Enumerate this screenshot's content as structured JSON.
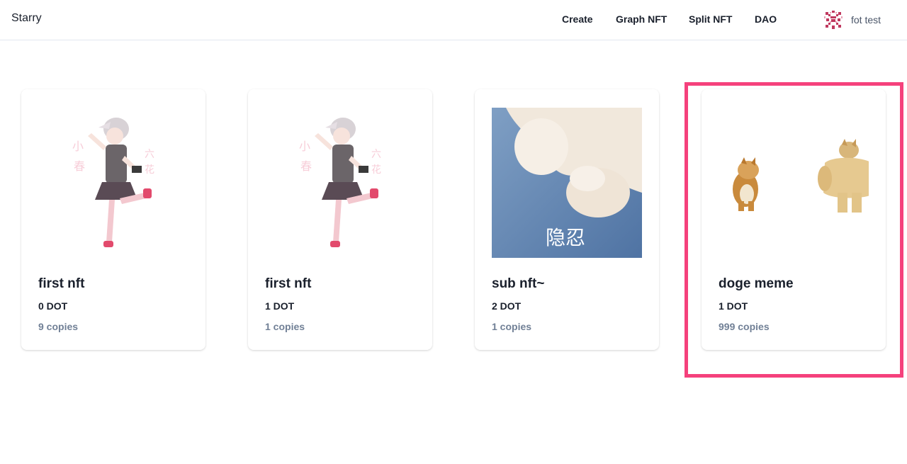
{
  "navbar": {
    "brand": "Starry",
    "links": [
      "Create",
      "Graph NFT",
      "Split NFT",
      "DAO"
    ],
    "account": {
      "name": "fot test",
      "avatar_icon": "identicon-avatar-icon"
    }
  },
  "cards": [
    {
      "title": "first nft",
      "price": "0 DOT",
      "copies": "9 copies",
      "image": "anime-girl-illustration"
    },
    {
      "title": "first nft",
      "price": "1 DOT",
      "copies": "1 copies",
      "image": "anime-girl-illustration"
    },
    {
      "title": "sub nft~",
      "price": "2 DOT",
      "copies": "1 copies",
      "image": "cat-paw-photo",
      "image_caption": "隐忍"
    },
    {
      "title": "doge meme",
      "price": "1 DOT",
      "copies": "999 copies",
      "image": "doge-meme"
    }
  ],
  "colors": {
    "highlight": "#f5417c",
    "muted_text": "#718096",
    "border": "#e2e8f0"
  }
}
